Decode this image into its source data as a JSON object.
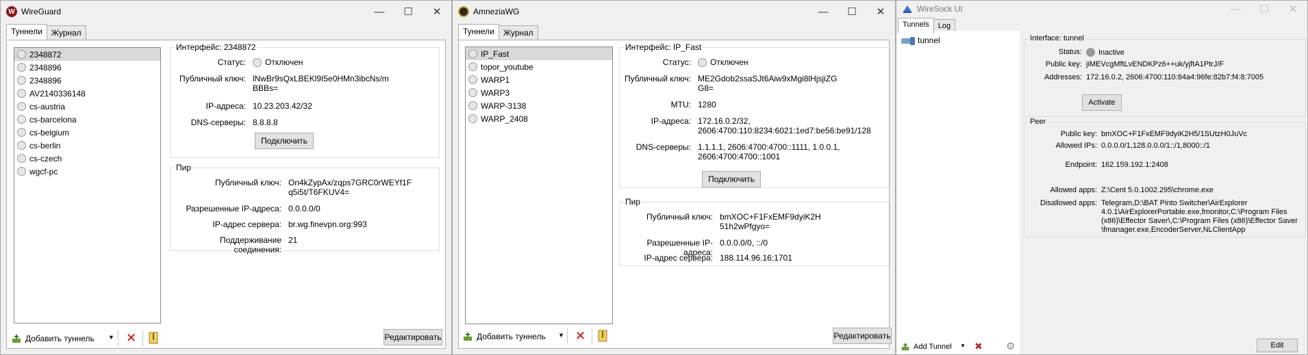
{
  "wireguard": {
    "title": "WireGuard",
    "tabs": [
      "Туннели",
      "Журнал"
    ],
    "tunnels": [
      "2348872",
      "2348896",
      "2348896",
      "AV2140336148",
      "cs-austria",
      "cs-barcelona",
      "cs-belgium",
      "cs-berlin",
      "cs-czech",
      "wgcf-pc"
    ],
    "interface": {
      "legend": "Интерфейс: 2348872",
      "status_label": "Статус:",
      "status_value": "Отключен",
      "pubkey_label": "Публичный ключ:",
      "pubkey_value": "lNwBr9sQxLBEKl9I5e0HMn3ibcNs/m\nBBBs=",
      "ip_label": "IP-адреса:",
      "ip_value": "10.23.203.42/32",
      "dns_label": "DNS-серверы:",
      "dns_value": "8.8.8.8",
      "connect_button": "Подключить"
    },
    "peer": {
      "legend": "Пир",
      "pubkey_label": "Публичный ключ:",
      "pubkey_value": "On4kZypAx/zqps7GRC0rWEYf1F\nq5i5t/T6FKUV4=",
      "allowed_label": "Разрешенные IP-адреса:",
      "allowed_value": "0.0.0.0/0",
      "endpoint_label": "IP-адрес сервера:",
      "endpoint_value": "br.wg.finevpn.org:993",
      "keepalive_label": "Поддерживание соединения:",
      "keepalive_value": "21"
    },
    "add_tunnel": "Добавить туннель",
    "edit_button": "Редактировать"
  },
  "amnezia": {
    "title": "AmneziaWG",
    "tabs": [
      "Туннели",
      "Журнал"
    ],
    "tunnels": [
      "IP_Fast",
      "topor_youtube",
      "WARP1",
      "WARP3",
      "WARP-3138",
      "WARP_2408"
    ],
    "interface": {
      "legend": "Интерфейс: IP_Fast",
      "status_label": "Статус:",
      "status_value": "Отключен",
      "pubkey_label": "Публичный ключ:",
      "pubkey_value": "ME2Gdob2ssaSJt6Aiw9xMgi8lHjsjiZG\nG8=",
      "mtu_label": "MTU:",
      "mtu_value": "1280",
      "ip_label": "IP-адреса:",
      "ip_value": "172.16.0.2/32,\n2606:4700:110:8234:6021:1ed7:be56:be91/128",
      "dns_label": "DNS-серверы:",
      "dns_value": "1.1.1.1, 2606:4700:4700::1111, 1.0.0.1,\n2606:4700:4700::1001",
      "connect_button": "Подключить"
    },
    "peer": {
      "legend": "Пир",
      "pubkey_label": "Публичный ключ:",
      "pubkey_value": "bmXOC+F1FxEMF9dyiK2H\n51h2wPfgyo=",
      "allowed_label": "Разрешенные IP-адреса:",
      "allowed_value": "0.0.0.0/0, ::/0",
      "endpoint_label": "IP-адрес сервера:",
      "endpoint_value": "188.114.96.16:1701"
    },
    "add_tunnel": "Добавить туннель",
    "edit_button": "Редактировать"
  },
  "wiresock": {
    "title": "WireSock UI",
    "tabs": [
      "Tunnels",
      "Log"
    ],
    "tunnel_name": "tunnel",
    "interface": {
      "legend": "Interface: tunnel",
      "status_label": "Status:",
      "status_value": "Inactive",
      "pubkey_label": "Public key:",
      "pubkey_value": "jiMEVcgMftLvENDKPz6++uk/yjftA1PtrJ/F",
      "addr_label": "Addresses:",
      "addr_value": "172.16.0.2, 2606:4700:110:84a4:96fe:82b7:f4:8:7005",
      "activate_button": "Activate"
    },
    "peer": {
      "legend": "Peer",
      "pubkey_label": "Public key:",
      "pubkey_value": "bmXOC+F1FxEMF9dyiK2H5/1SUtzH0JuVc",
      "allowed_label": "Allowed IPs:",
      "allowed_value": "0.0.0.0/1,128.0.0.0/1::/1,8000::/1",
      "endpoint_label": "Endpoint:",
      "endpoint_value": "162.159.192.1:2408",
      "apps_label": "Allowed apps:",
      "apps_value": "Z:\\Cent 5.0.1002.295\\chrome.exe",
      "disallowed_label": "Disallowed apps:",
      "disallowed_value": "Telegram,D:\\BAT Pinto Switcher\\AirExplorer\n4.0.1\\AirExplorerPortable.exe,fmonitor,C:\\Program Files\n(x86)\\Effector Saver\\,C:\\Program Files (x86)\\Effector Saver\n\\fmanager.exe,EncoderServer,NLClientApp"
    },
    "add_tunnel": "Add Tunnel",
    "edit_button": "Edit"
  },
  "colors": {
    "titlebar_active": "#ffffff",
    "selection": "#d9d9d9",
    "delete_red": "#d40000",
    "wireguard_red": "#88171a"
  }
}
